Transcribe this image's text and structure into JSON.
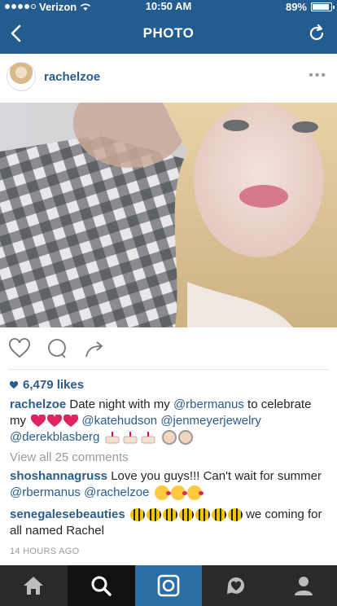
{
  "status": {
    "carrier": "Verizon",
    "time": "10:50 AM",
    "battery": "89%",
    "battery_level": 0.89
  },
  "nav": {
    "title": "PHOTO"
  },
  "post": {
    "username": "rachelzoe",
    "likes": "6,479 likes",
    "caption": {
      "user": "rachelzoe",
      "text1": "Date night with my",
      "m1": "@rbermanus",
      "text2": "to celebrate my",
      "m2": "@katehudson",
      "m3": "@jenmeyerjewelry",
      "m4": "@derekblasberg"
    },
    "view_all": "View all 25 comments",
    "comments": [
      {
        "user": "shoshannagruss",
        "text": "Love you guys!!! Can't wait for summer",
        "m1": "@rbermanus",
        "m2": "@rachelzoe"
      },
      {
        "user": "senegalesebeauties",
        "text": "we coming for all named Rachel"
      }
    ],
    "time_ago": "14 HOURS AGO"
  },
  "icons": {
    "back": "chevron-left-icon",
    "refresh": "refresh-icon",
    "more": "more-icon",
    "like": "heart-outline-icon",
    "comment": "comment-icon",
    "share": "share-icon"
  },
  "tabbar": [
    {
      "name": "home",
      "icon": "home-icon"
    },
    {
      "name": "search",
      "icon": "search-icon"
    },
    {
      "name": "camera",
      "icon": "camera-icon"
    },
    {
      "name": "activity",
      "icon": "activity-heart-icon"
    },
    {
      "name": "profile",
      "icon": "profile-icon"
    }
  ],
  "colors": {
    "header": "#235c8f",
    "link": "#2a5d8a",
    "tabbar": "#2a2a2a",
    "camera_tab": "#2a6fa3"
  }
}
